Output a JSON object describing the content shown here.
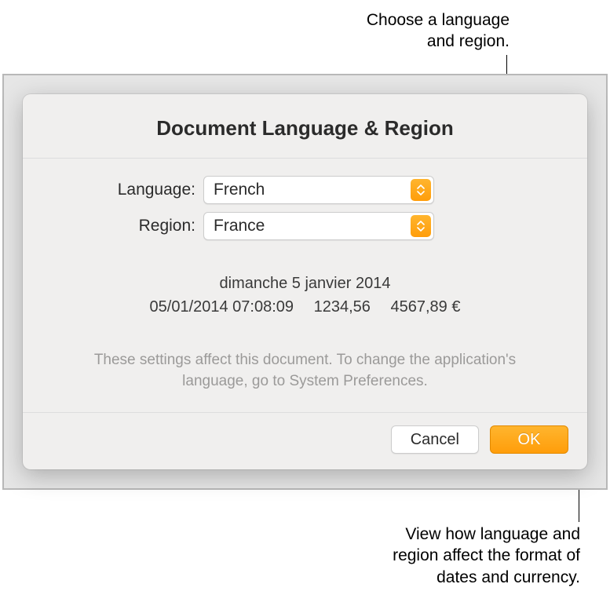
{
  "callouts": {
    "top": "Choose a language\nand region.",
    "bottom": "View how language and\nregion affect the format of\ndates and currency."
  },
  "dialog": {
    "title": "Document Language & Region",
    "form": {
      "language_label": "Language:",
      "language_value": "French",
      "region_label": "Region:",
      "region_value": "France"
    },
    "preview": {
      "date_long": "dimanche 5 janvier 2014",
      "date_time": "05/01/2014 07:08:09",
      "number": "1234,56",
      "currency": "4567,89 €"
    },
    "hint": "These settings affect this document. To change the application's\nlanguage, go to System Preferences.",
    "buttons": {
      "cancel": "Cancel",
      "ok": "OK"
    }
  }
}
